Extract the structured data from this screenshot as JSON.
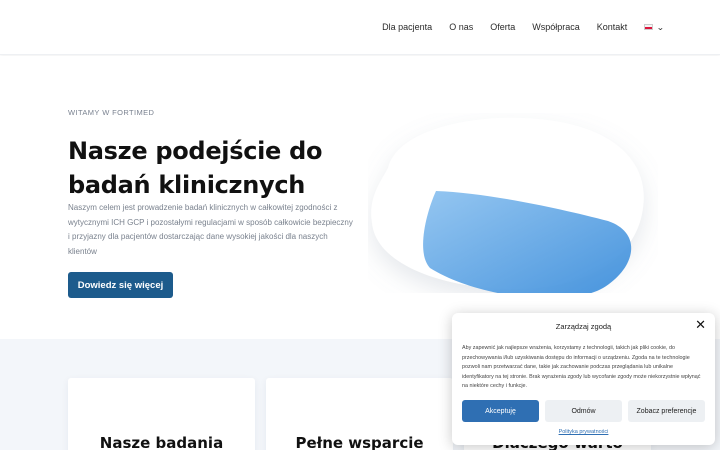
{
  "header": {
    "nav": [
      {
        "label": "Dla pacjenta"
      },
      {
        "label": "O nas"
      },
      {
        "label": "Oferta"
      },
      {
        "label": "Współpraca"
      },
      {
        "label": "Kontakt"
      }
    ],
    "language_icon": "poland-flag-icon",
    "dropdown_icon": "chevron-down-icon"
  },
  "hero": {
    "eyebrow": "WITAMY W FORTIMED",
    "title_line1": "Nasze podejście do",
    "title_line2": "badań klinicznych",
    "lead": "Naszym celem jest prowadzenie badań klinicznych w całkowitej zgodności z wytycznymi ICH GCP i pozostałymi regulacjami w sposób całkowicie bezpieczny i przyjazny dla pacjentów dostarczając dane wysokiej jakości dla naszych klientów",
    "cta_label": "Dowiedz się więcej"
  },
  "cards": [
    {
      "title": "Nasze badania"
    },
    {
      "title": "Pełne wsparcie"
    },
    {
      "title": "Dlaczego warto"
    }
  ],
  "cookie": {
    "title": "Zarządzaj zgodą",
    "close_icon": "close-icon",
    "text": "Aby zapewnić jak najlepsze wrażenia, korzystamy z technologii, takich jak pliki cookie, do przechowywania i/lub uzyskiwania dostępu do informacji o urządzeniu. Zgoda na te technologie pozwoli nam przetwarzać dane, takie jak zachowanie podczas przeglądania lub unikalne identyfikatory na tej stronie. Brak wyrażenia zgody lub wycofanie zgody może niekorzystnie wpłynąć na niektóre cechy i funkcje.",
    "accept_label": "Akceptuję",
    "deny_label": "Odmów",
    "prefs_label": "Zobacz preferencje",
    "policy_link": "Polityka prywatności"
  },
  "colors": {
    "primary": "#1d5b8c",
    "cookie_accent": "#2f6fb3",
    "band_bg": "#f3f6fa"
  }
}
